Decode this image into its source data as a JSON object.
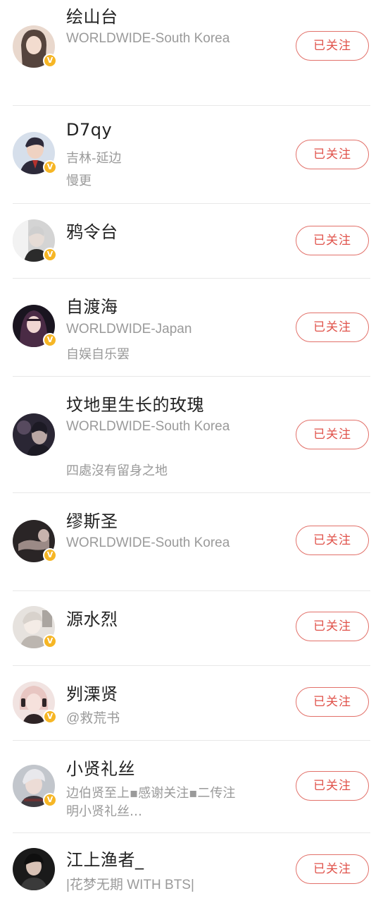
{
  "users": [
    {
      "name": "绘山台",
      "lines": [
        "WORLDWIDE-South Korea"
      ],
      "follow_label": "已关注",
      "verified_mark": "V",
      "avatar_colors": [
        "#d9b7a5",
        "#3b2a23"
      ]
    },
    {
      "name": "D7qy",
      "lines": [
        "吉林-延边",
        "慢更"
      ],
      "follow_label": "已关注",
      "verified_mark": "V",
      "avatar_colors": [
        "#c9d4e2",
        "#2d2a3a"
      ]
    },
    {
      "name": "鸦令台",
      "lines": [],
      "follow_label": "已关注",
      "verified_mark": "V",
      "avatar_colors": [
        "#bfbfbf",
        "#2b2b2b"
      ]
    },
    {
      "name": "自渡海",
      "lines": [
        "WORLDWIDE-Japan",
        "自娱自乐罢"
      ],
      "follow_label": "已关注",
      "verified_mark": "V",
      "avatar_colors": [
        "#4a2b45",
        "#1a1520"
      ]
    },
    {
      "name": "坟地里生长的玫瑰",
      "lines": [
        "WORLDWIDE-South Korea",
        " 四處沒有留身之地"
      ],
      "follow_label": "已关注",
      "verified_mark": "",
      "avatar_colors": [
        "#6b5a72",
        "#1c1a24"
      ]
    },
    {
      "name": "缪斯圣",
      "lines": [
        "WORLDWIDE-South Korea"
      ],
      "follow_label": "已关注",
      "verified_mark": "V",
      "avatar_colors": [
        "#2a2526",
        "#9b8a86"
      ]
    },
    {
      "name": "源水烈",
      "lines": [],
      "follow_label": "已关注",
      "verified_mark": "V",
      "avatar_colors": [
        "#e6e2de",
        "#6e6862"
      ]
    },
    {
      "name": "刿溧贤",
      "lines": [
        "@救荒书"
      ],
      "follow_label": "已关注",
      "verified_mark": "V",
      "avatar_colors": [
        "#e8c6c2",
        "#2e2426"
      ]
    },
    {
      "name": "小贤礼丝",
      "lines": [
        "边伯贤至上▪感谢关注▪二传注",
        "明小贤礼丝…"
      ],
      "follow_label": "已关注",
      "verified_mark": "V",
      "avatar_colors": [
        "#c2c6cc",
        "#3e3a40"
      ]
    },
    {
      "name": "江上渔者_",
      "lines": [
        "|花梦无期 WITH BTS|"
      ],
      "follow_label": "已关注",
      "verified_mark": "",
      "avatar_colors": [
        "#3a3a3a",
        "#0f0f0f"
      ]
    }
  ]
}
